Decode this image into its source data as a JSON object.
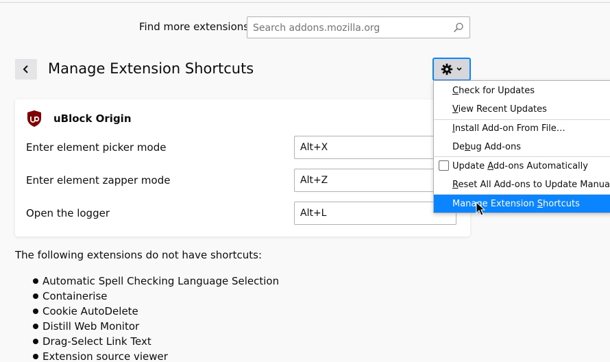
{
  "find": {
    "label": "Find more extensions",
    "placeholder": "Search addons.mozilla.org"
  },
  "header": {
    "title": "Manage Extension Shortcuts"
  },
  "addon": {
    "name": "uBlock Origin",
    "shortcuts": [
      {
        "label": "Enter element picker mode",
        "value": "Alt+X"
      },
      {
        "label": "Enter element zapper mode",
        "value": "Alt+Z"
      },
      {
        "label": "Open the logger",
        "value": "Alt+L"
      }
    ]
  },
  "no_shortcuts": {
    "title": "The following extensions do not have shortcuts:",
    "items": [
      "Automatic Spell Checking Language Selection",
      "Containerise",
      "Cookie AutoDelete",
      "Distill Web Monitor",
      "Drag-Select Link Text",
      "Extension source viewer"
    ]
  },
  "menu": {
    "check_updates": {
      "pre": "",
      "key": "C",
      "post": "heck for Updates"
    },
    "view_recent": {
      "pre": "",
      "key": "V",
      "post": "iew Recent Updates"
    },
    "install_file": {
      "pre": "",
      "key": "I",
      "post": "nstall Add-on From File…"
    },
    "debug": {
      "pre": "De",
      "key": "b",
      "post": "ug Add-ons"
    },
    "auto_update": {
      "pre": "Update ",
      "key": "A",
      "post": "dd-ons Automatically"
    },
    "reset_all": {
      "pre": "",
      "key": "R",
      "post": "eset All Add-ons to Update Manually"
    },
    "manage_shortcuts": {
      "pre": "Manage Extension ",
      "key": "S",
      "post": "hortcuts"
    }
  },
  "colors": {
    "accent": "#0a84ff",
    "ublock_red": "#800000"
  }
}
